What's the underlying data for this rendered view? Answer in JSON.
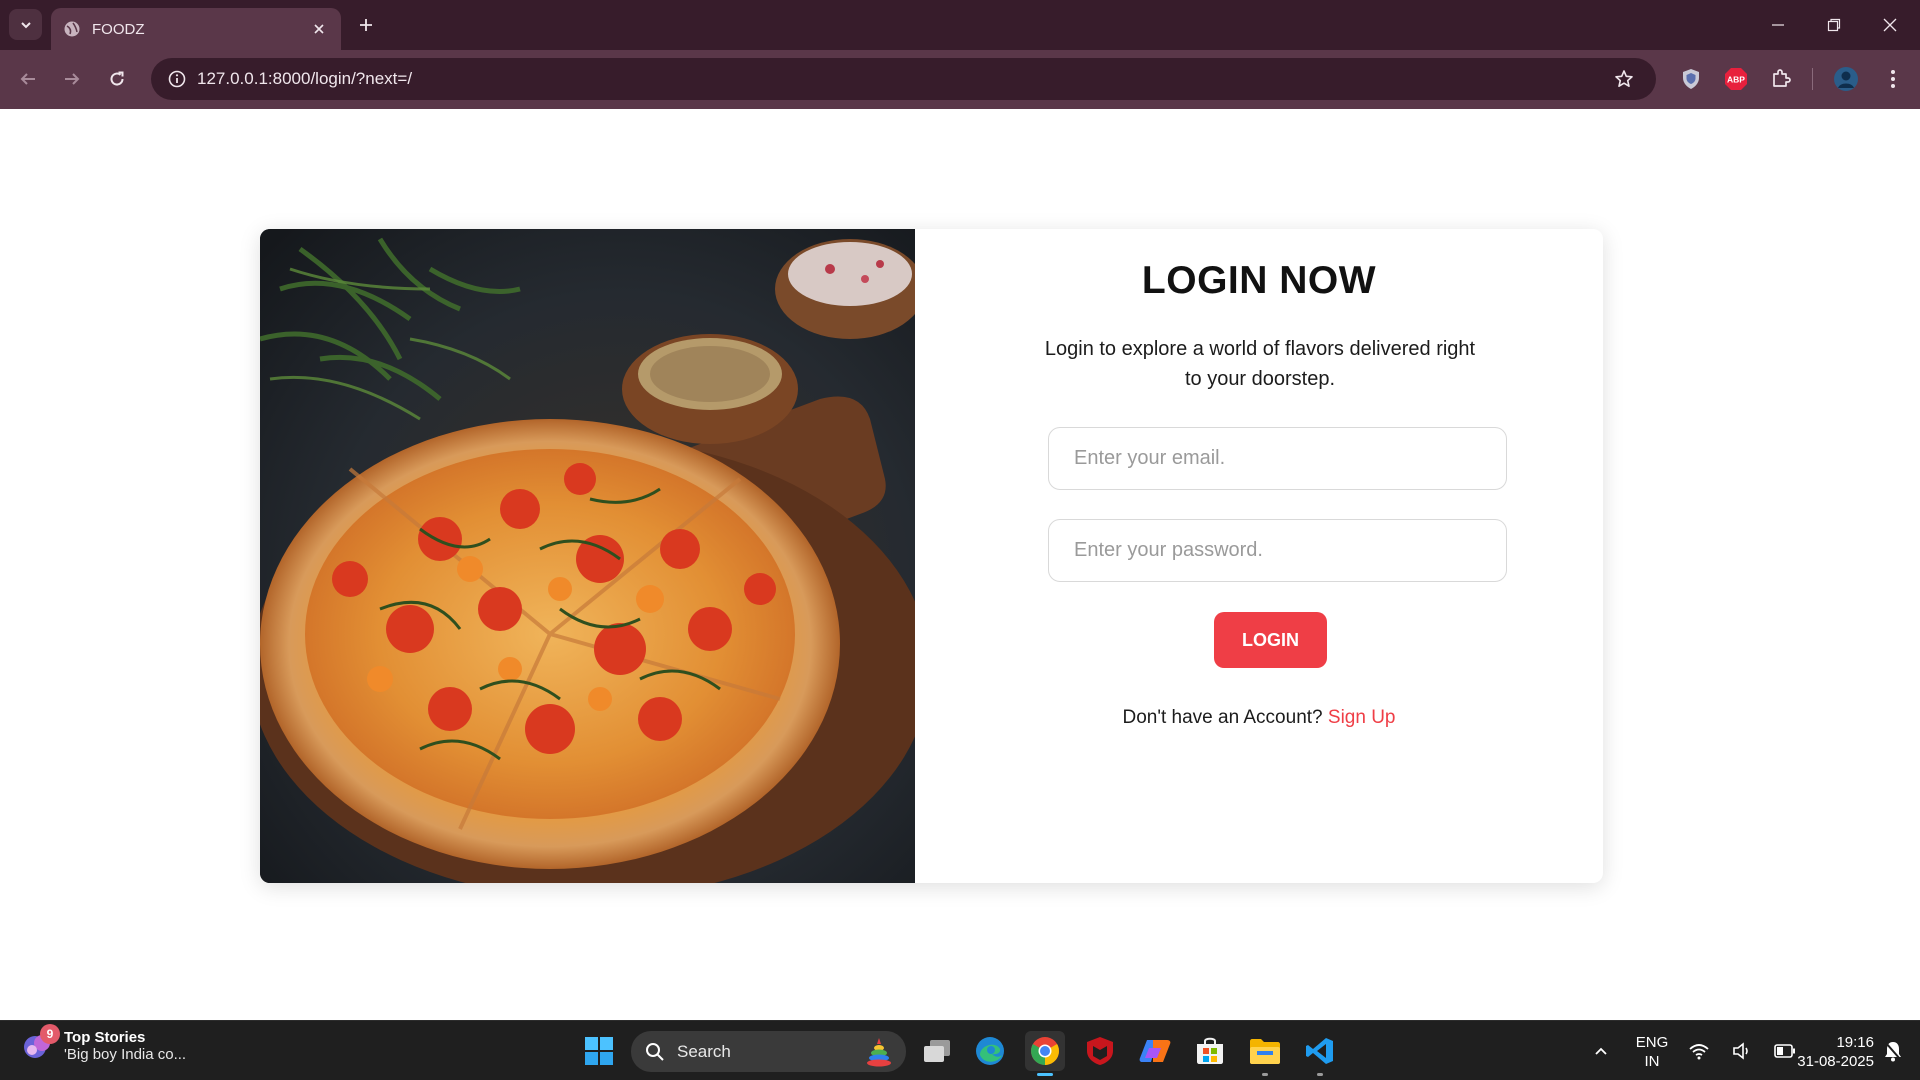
{
  "browser": {
    "tab": {
      "title": "FOODZ"
    },
    "url": "127.0.0.1:8000/login/?next=/",
    "extensions": [
      "shield-extension",
      "adblock-plus-extension",
      "extensions-puzzle",
      "profile-avatar"
    ],
    "adblock_label": "ABP"
  },
  "login_page": {
    "heading": "LOGIN NOW",
    "subtext": "Login to explore a world of flavors delivered right to your doorstep.",
    "email_placeholder": "Enter your email.",
    "password_placeholder": "Enter your password.",
    "login_button": "LOGIN",
    "no_account_text": "Don't have an Account?",
    "signup_link": "Sign Up",
    "accent_color": "#ef3e46"
  },
  "taskbar": {
    "news": {
      "badge": "9",
      "title": "Top Stories",
      "headline": "'Big boy India co..."
    },
    "search_label": "Search",
    "language": {
      "line1": "ENG",
      "line2": "IN"
    },
    "clock": {
      "time": "19:16",
      "date": "31-08-2025"
    },
    "apps": [
      "start",
      "search",
      "task-view",
      "edge",
      "chrome",
      "mcafee",
      "copilot",
      "microsoft-store",
      "file-explorer",
      "vscode"
    ]
  }
}
